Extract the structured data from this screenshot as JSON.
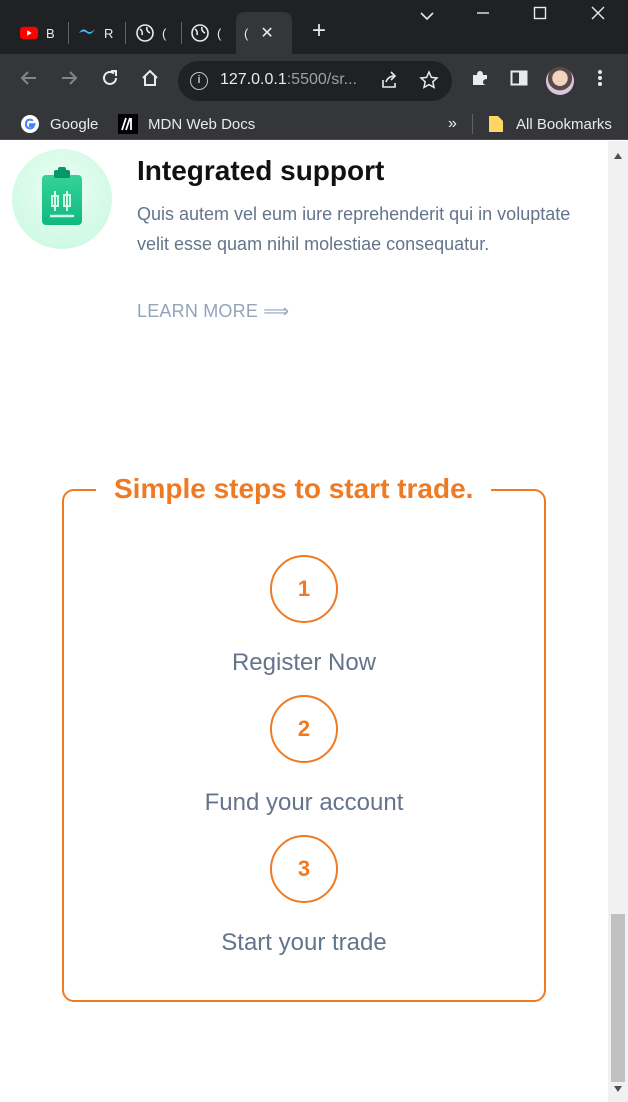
{
  "browser": {
    "tabs": [
      {
        "label": "B",
        "icon": "youtube-icon"
      },
      {
        "label": "R",
        "icon": "tailwind-icon"
      },
      {
        "label": "(",
        "icon": "globe-icon"
      },
      {
        "label": "(",
        "icon": "globe-icon"
      },
      {
        "label": "(",
        "icon": "globe-icon",
        "active": true
      }
    ],
    "new_tab_label": "+",
    "url_host": "127.0.0.1",
    "url_rest": ":5500/sr...",
    "bookmarks": [
      {
        "label": "Google",
        "icon": "google-icon"
      },
      {
        "label": "MDN Web Docs",
        "icon": "mdn-icon"
      }
    ],
    "bookmarks_overflow": "»",
    "all_bookmarks_label": "All Bookmarks"
  },
  "feature": {
    "title": "Integrated support",
    "text": "Quis autem vel eum iure reprehenderit qui in voluptate velit esse quam nihil molestiae consequatur.",
    "link_label": "LEARN MORE ⟹"
  },
  "steps": {
    "title": "Simple steps to start trade.",
    "items": [
      {
        "number": "1",
        "label": "Register Now"
      },
      {
        "number": "2",
        "label": "Fund your account"
      },
      {
        "number": "3",
        "label": "Start your trade"
      }
    ]
  },
  "colors": {
    "accent": "#f07a23",
    "text_muted": "#64748b",
    "link_muted": "#94a3b8",
    "icon_bg": "#d1fae5",
    "icon_fg": "#10b981"
  }
}
